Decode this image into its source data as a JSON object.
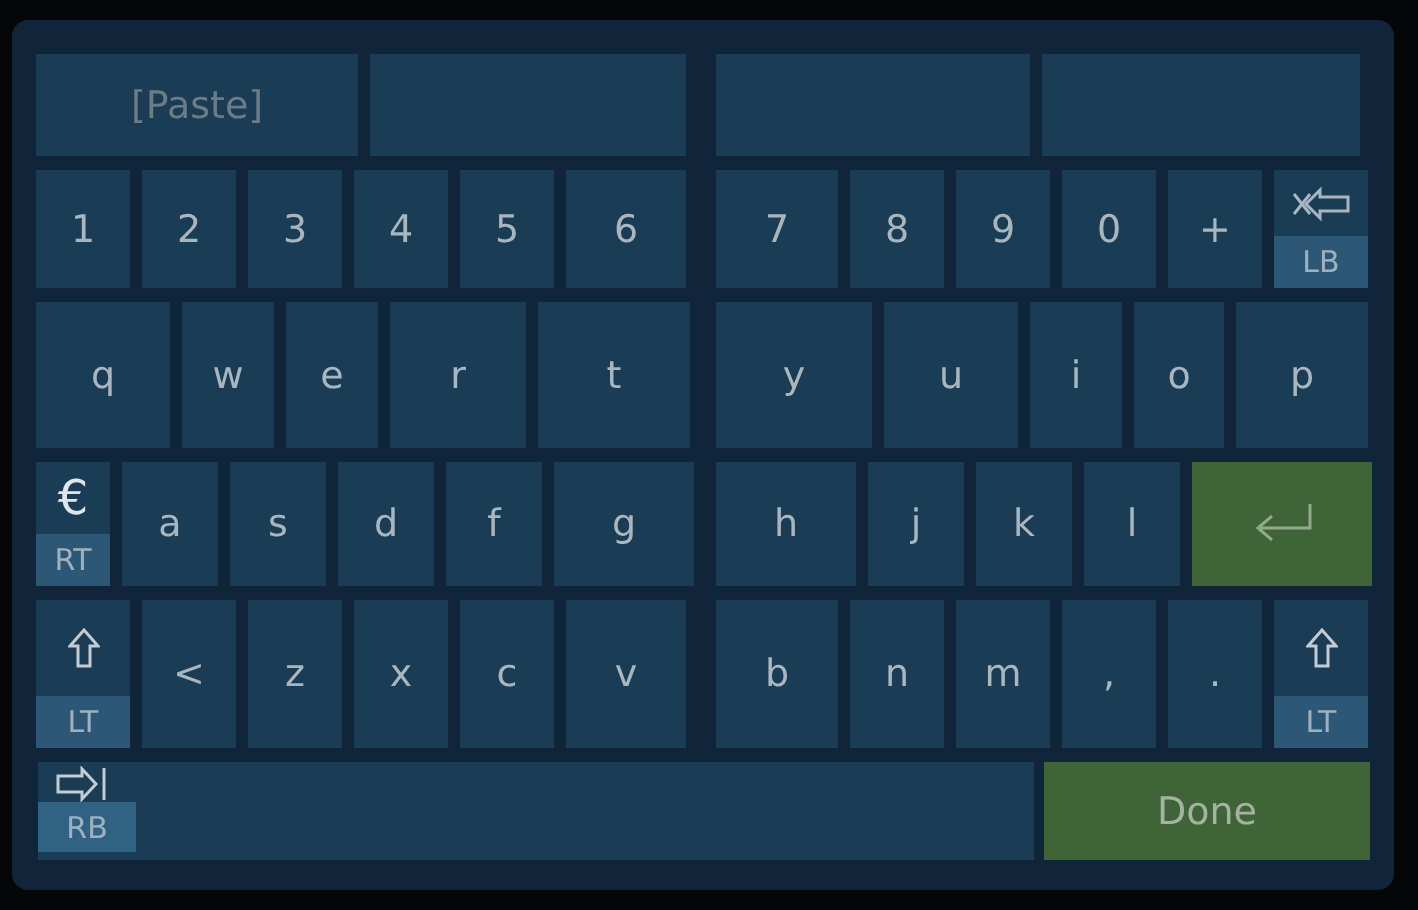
{
  "keyboard": {
    "rows": [
      {
        "left": [
          {
            "kind": "paste",
            "label": "[Paste]",
            "disabled": true
          },
          {
            "kind": "blank"
          }
        ],
        "right": [
          {
            "kind": "blank"
          },
          {
            "kind": "blank"
          }
        ]
      },
      {
        "left": [
          {
            "kind": "char",
            "label": "1"
          },
          {
            "kind": "char",
            "label": "2"
          },
          {
            "kind": "char",
            "label": "3"
          },
          {
            "kind": "char",
            "label": "4"
          },
          {
            "kind": "char",
            "label": "5"
          },
          {
            "kind": "char",
            "label": "6"
          }
        ],
        "right": [
          {
            "kind": "char",
            "label": "7"
          },
          {
            "kind": "char",
            "label": "8"
          },
          {
            "kind": "char",
            "label": "9"
          },
          {
            "kind": "char",
            "label": "0"
          },
          {
            "kind": "char",
            "label": "+"
          },
          {
            "kind": "backspace",
            "badge": "LB"
          }
        ]
      },
      {
        "left": [
          {
            "kind": "char",
            "label": "q"
          },
          {
            "kind": "char",
            "label": "w"
          },
          {
            "kind": "char",
            "label": "e"
          },
          {
            "kind": "char",
            "label": "r"
          },
          {
            "kind": "char",
            "label": "t"
          }
        ],
        "right": [
          {
            "kind": "char",
            "label": "y"
          },
          {
            "kind": "char",
            "label": "u"
          },
          {
            "kind": "char",
            "label": "i"
          },
          {
            "kind": "char",
            "label": "o"
          },
          {
            "kind": "char",
            "label": "p"
          }
        ]
      },
      {
        "left": [
          {
            "kind": "symbol",
            "label": "€",
            "badge": "RT"
          },
          {
            "kind": "char",
            "label": "a"
          },
          {
            "kind": "char",
            "label": "s"
          },
          {
            "kind": "char",
            "label": "d"
          },
          {
            "kind": "char",
            "label": "f"
          },
          {
            "kind": "char",
            "label": "g"
          }
        ],
        "right": [
          {
            "kind": "char",
            "label": "h"
          },
          {
            "kind": "char",
            "label": "j"
          },
          {
            "kind": "char",
            "label": "k"
          },
          {
            "kind": "char",
            "label": "l"
          },
          {
            "kind": "enter"
          }
        ]
      },
      {
        "left": [
          {
            "kind": "shift",
            "badge": "LT"
          },
          {
            "kind": "char",
            "label": "<"
          },
          {
            "kind": "char",
            "label": "z"
          },
          {
            "kind": "char",
            "label": "x"
          },
          {
            "kind": "char",
            "label": "c"
          },
          {
            "kind": "char",
            "label": "v"
          }
        ],
        "right": [
          {
            "kind": "char",
            "label": "b"
          },
          {
            "kind": "char",
            "label": "n"
          },
          {
            "kind": "char",
            "label": "m"
          },
          {
            "kind": "char",
            "label": ","
          },
          {
            "kind": "char",
            "label": "."
          },
          {
            "kind": "shift",
            "badge": "LT"
          }
        ]
      }
    ],
    "bottom_row": [
      {
        "kind": "space",
        "badge": "RB"
      },
      {
        "kind": "done",
        "label": "Done"
      }
    ]
  }
}
